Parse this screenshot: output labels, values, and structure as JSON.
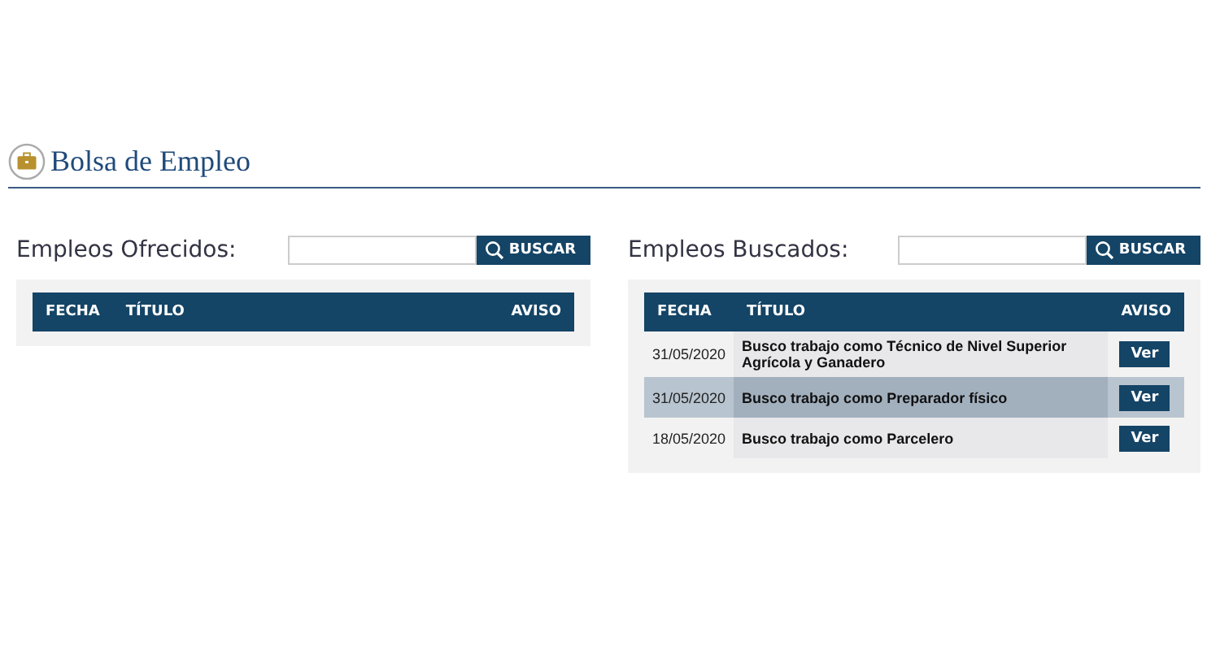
{
  "header": {
    "title": "Bolsa de Empleo"
  },
  "sections": [
    {
      "title": "Empleos Ofrecidos:",
      "search": {
        "button": "BUSCAR"
      },
      "columns": [
        "FECHA",
        "TÍTULO",
        "AVISO"
      ]
    },
    {
      "title": "Empleos Buscados:",
      "search": {
        "button": "BUSCAR"
      },
      "columns": [
        "FECHA",
        "TÍTULO",
        "AVISO"
      ],
      "rows": [
        {
          "date": "31/05/2020",
          "title": "Busco trabajo como Técnico de Nivel Superior Agrícola y Ganadero",
          "action": "Ver",
          "selected": false
        },
        {
          "date": "31/05/2020",
          "title": "Busco trabajo como Preparador físico",
          "action": "Ver",
          "selected": true
        },
        {
          "date": "18/05/2020",
          "title": "Busco trabajo como Parcelero",
          "action": "Ver",
          "selected": false
        }
      ]
    }
  ]
}
